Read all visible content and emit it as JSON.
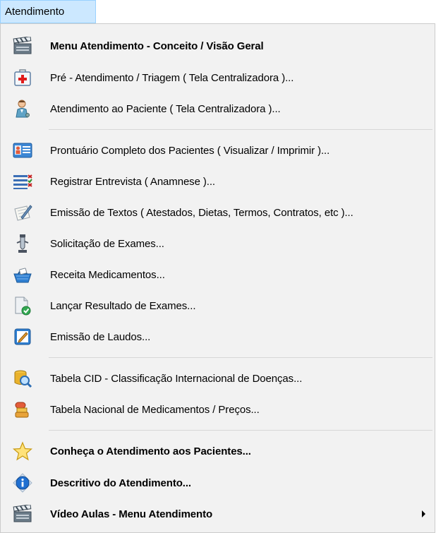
{
  "menubar": {
    "title": "Atendimento"
  },
  "menu": {
    "items": [
      {
        "label": "Menu Atendimento - Conceito / Visão Geral",
        "icon": "clapperboard-icon",
        "bold": true
      },
      {
        "label": "Pré - Atendimento / Triagem ( Tela Centralizadora )...",
        "icon": "first-aid-kit-icon",
        "bold": false
      },
      {
        "label": "Atendimento ao Paciente ( Tela Centralizadora )...",
        "icon": "doctor-icon",
        "bold": false
      },
      {
        "label": "Prontuário Completo dos Pacientes ( Visualizar / Imprimir )...",
        "icon": "id-card-icon",
        "bold": false
      },
      {
        "label": "Registrar Entrevista ( Anamnese )...",
        "icon": "checklist-icon",
        "bold": false
      },
      {
        "label": "Emissão de Textos ( Atestados, Dietas, Termos, Contratos, etc )...",
        "icon": "pen-paper-icon",
        "bold": false
      },
      {
        "label": "Solicitação de Exames...",
        "icon": "exam-tube-icon",
        "bold": false
      },
      {
        "label": "Receita Medicamentos...",
        "icon": "medicine-basket-icon",
        "bold": false
      },
      {
        "label": "Lançar Resultado de Exames...",
        "icon": "document-check-icon",
        "bold": false
      },
      {
        "label": "Emissão de Laudos...",
        "icon": "edit-report-icon",
        "bold": false
      },
      {
        "label": "Tabela CID - Classificação Internacional de Doenças...",
        "icon": "database-search-icon",
        "bold": false
      },
      {
        "label": "Tabela Nacional de Medicamentos / Preços...",
        "icon": "pill-icon",
        "bold": false
      },
      {
        "label": "Conheça o Atendimento aos Pacientes...",
        "icon": "star-icon",
        "bold": true
      },
      {
        "label": "Descritivo do Atendimento...",
        "icon": "info-icon",
        "bold": true
      },
      {
        "label": "Vídeo Aulas - Menu Atendimento",
        "icon": "clapperboard-icon",
        "bold": true
      }
    ]
  }
}
